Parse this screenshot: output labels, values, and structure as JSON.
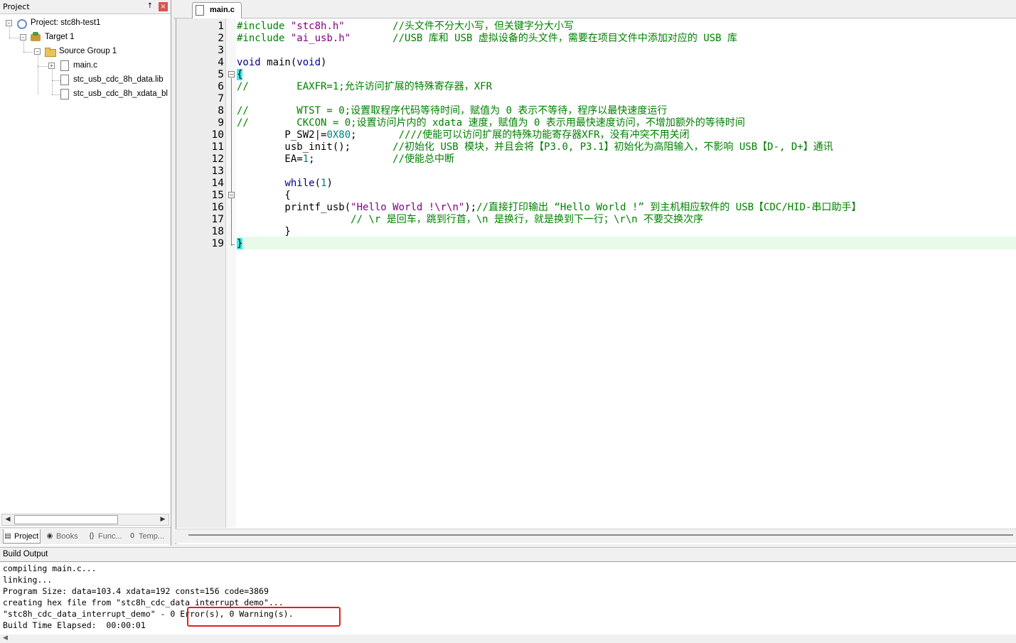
{
  "project_panel": {
    "title": "Project",
    "pin": "↑",
    "close": "×",
    "tree": {
      "project": "Project: stc8h-test1",
      "target": "Target 1",
      "group": "Source Group 1",
      "files": [
        "main.c",
        "stc_usb_cdc_8h_data.lib",
        "stc_usb_cdc_8h_xdata_bl"
      ]
    },
    "tabs": [
      "Project",
      "Books",
      "Func...",
      "Temp..."
    ]
  },
  "editor": {
    "active_tab": "main.c",
    "line_numbers": [
      "1",
      "2",
      "3",
      "4",
      "5",
      "6",
      "7",
      "8",
      "9",
      "10",
      "11",
      "12",
      "13",
      "14",
      "15",
      "16",
      "17",
      "18",
      "19"
    ],
    "code": {
      "l1_dir": "#include",
      "l1_str": "\"stc8h.h\"",
      "l1_cmt": "        //头文件不分大小写，但关键字分大小写",
      "l2_dir": "#include",
      "l2_str": "\"ai_usb.h\"",
      "l2_cmt": "       //USB 库和 USB 虚拟设备的头文件，需要在项目文件中添加对应的 USB 库",
      "l4_kw1": "void",
      "l4_fn": " main(",
      "l4_kw2": "void",
      "l4_end": ")",
      "l5": "{",
      "l6": "//        EAXFR=1;允许访问扩展的特殊寄存器，XFR",
      "l8": "//        WTST = 0;设置取程序代码等待时间，赋值为 0 表示不等待，程序以最快速度运行",
      "l9": "//        CKCON = 0;设置访问片内的 xdata 速度，赋值为 0 表示用最快速度访问，不增加额外的等待时间",
      "l10_a": "        P_SW2|=",
      "l10_num": "0X80",
      "l10_pad": ";       ",
      "l10_cmt": "////使能可以访问扩展的特殊功能寄存器XFR，没有冲突不用关闭",
      "l11_a": "        usb_init();       ",
      "l11_cmt": "//初始化 USB 模块，并且会将【P3.0, P3.1】初始化为高阻输入，不影响 USB【D-, D+】通讯",
      "l12_a": "        EA=",
      "l12_num": "1",
      "l12_pad": ";             ",
      "l12_cmt": "//使能总中断",
      "l14_pad": "        ",
      "l14_kw": "while",
      "l14_a": "(",
      "l14_num": "1",
      "l14_b": ")",
      "l15": "        {",
      "l16_a": "        printf_usb(",
      "l16_str": "\"Hello World !\\r\\n\"",
      "l16_b": ");",
      "l16_cmt": "//直接打印输出 “Hello World !” 到主机相应软件的 USB【CDC/HID-串口助手】",
      "l17": "                   // \\r 是回车，跳到行首，\\n 是换行，就是换到下一行；\\r\\n 不要交换次序",
      "l18": "        }",
      "l19": "}"
    }
  },
  "build_output": {
    "title": "Build Output",
    "lines": [
      "compiling main.c...",
      "linking...",
      "Program Size: data=103.4 xdata=192 const=156 code=3869",
      "creating hex file from \"stc8h_cdc_data_interrupt_demo\"...",
      "\"stc8h_cdc_data_interrupt_demo\" - 0 Error(s), 0 Warning(s).",
      "Build Time Elapsed:  00:00:01"
    ]
  },
  "colors": {
    "keyword": "#00008b",
    "comment": "#008000",
    "string": "#800080",
    "number": "#008080",
    "highlight_box": "#e02020",
    "current_line": "#e8fbe8",
    "brace_match": "#3ee8e8"
  }
}
